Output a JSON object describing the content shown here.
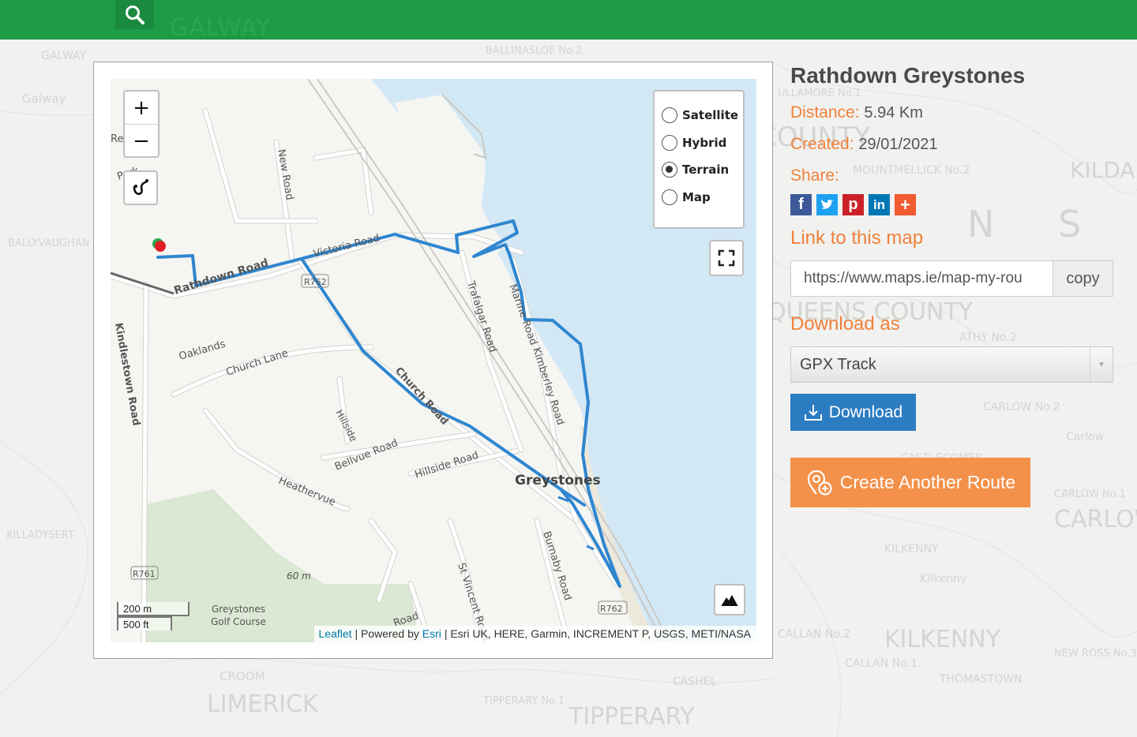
{
  "header": {
    "search_icon": "search-icon",
    "bg_text": "GALWAY",
    "accent_color": "#1e9b46"
  },
  "background_map": {
    "labels": [
      "GALWAY",
      "Galway",
      "BALLYVAUGHAN",
      "BALLINASLOE No.2",
      "ULLAMORE No.1",
      "KILDARE",
      "COUNTY",
      "MOUNTMELLICK No.2",
      "N",
      "S",
      "QUEENS COUNTY",
      "ATHY No.2",
      "CARLOW No.2",
      "Carlow",
      "KILLADYSERT",
      "LIMERICK",
      "CROOM",
      "TIPPERARY",
      "TIPPERARY No.1",
      "CASHEL",
      "KILKENNY",
      "Kilkenny",
      "CALLAN No.2",
      "CALLAN No.1",
      "THOMASTOWN",
      "CARLOW",
      "NEW ROSS No.3",
      "CARLOW No.1",
      "CASTLECOMER"
    ]
  },
  "map": {
    "zoom_in": "+",
    "zoom_out": "−",
    "layers": [
      {
        "label": "Satellite",
        "checked": false
      },
      {
        "label": "Hybrid",
        "checked": false
      },
      {
        "label": "Terrain",
        "checked": true
      },
      {
        "label": "Map",
        "checked": false
      }
    ],
    "road_labels": [
      "New Road",
      "Victoria Road",
      "Rathdown Road",
      "R762",
      "Oaklands",
      "Church Lane",
      "Kindlestown Road",
      "Church Road",
      "Hillside",
      "Bellvue Road",
      "Hillside Road",
      "Heathervue",
      "Trafalgar Road",
      "Kimberley Road",
      "Marine Road",
      "Greystones",
      "Burnaby Road",
      "St Vincent Road",
      "R761",
      "60 m",
      "Greystones Golf Course",
      "R762",
      "Road",
      "Park",
      "Re"
    ],
    "scale_metric": "200 m",
    "scale_imperial": "500 ft",
    "attribution": {
      "leaflet": "Leaflet",
      "powered": "| Powered by",
      "esri": "Esri",
      "rest": "| Esri UK, HERE, Garmin, INCREMENT P, USGS, METI/NASA"
    },
    "route_color": "#2f86cf"
  },
  "sidebar": {
    "title": "Rathdown Greystones",
    "distance_label": "Distance:",
    "distance_value": "5.94 Km",
    "created_label": "Created:",
    "created_value": "29/01/2021",
    "share_label": "Share:",
    "share_buttons": [
      {
        "name": "facebook",
        "glyph": "f",
        "color": "#3b5998"
      },
      {
        "name": "twitter",
        "glyph": "t",
        "color": "#1da1f2"
      },
      {
        "name": "pinterest",
        "glyph": "p",
        "color": "#cb2027"
      },
      {
        "name": "linkedin",
        "glyph": "in",
        "color": "#0077b5"
      },
      {
        "name": "more",
        "glyph": "+",
        "color": "#f25a30"
      }
    ],
    "link_label": "Link to this map",
    "link_value": "https://www.maps.ie/map-my-rou",
    "copy_label": "copy",
    "download_label": "Download as",
    "format_selected": "GPX Track",
    "download_button": "Download",
    "create_button": "Create Another Route",
    "orange": "#f0813a"
  }
}
